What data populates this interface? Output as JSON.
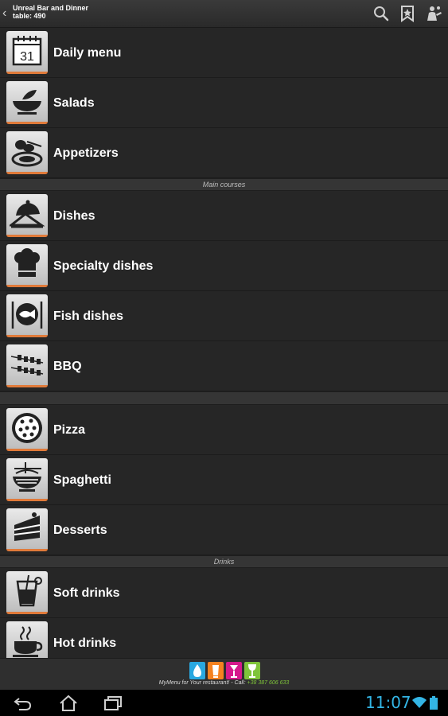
{
  "header": {
    "restaurant": "Unreal Bar and Dinner",
    "table": "table: 490"
  },
  "menu": {
    "rows": [
      {
        "label": "Daily menu",
        "icon": "calendar-icon"
      },
      {
        "label": "Salads",
        "icon": "salad-bowl-icon"
      },
      {
        "label": "Appetizers",
        "icon": "appetizer-plate-icon"
      },
      {
        "label": "Dishes",
        "icon": "cloche-icon"
      },
      {
        "label": "Specialty dishes",
        "icon": "chef-hat-icon"
      },
      {
        "label": "Fish dishes",
        "icon": "fish-plate-icon"
      },
      {
        "label": "BBQ",
        "icon": "skewers-icon"
      },
      {
        "label": "Pizza",
        "icon": "pizza-icon"
      },
      {
        "label": "Spaghetti",
        "icon": "spaghetti-bowl-icon"
      },
      {
        "label": "Desserts",
        "icon": "cake-slice-icon"
      },
      {
        "label": "Soft drinks",
        "icon": "soft-drink-glass-icon"
      },
      {
        "label": "Hot drinks",
        "icon": "coffee-cup-icon"
      }
    ],
    "sections": {
      "main_courses": "Main courses",
      "drinks": "Drinks"
    },
    "calendar_day": "31"
  },
  "footer": {
    "promo_text": "MyMenu for Your restaurant! - Call: ",
    "phone": "+38 387 606 633"
  },
  "status": {
    "time": "11:07"
  },
  "colors": {
    "accent_clock": "#33b5e5",
    "tile_underline": "#e07a3a",
    "phone_green": "#7fc43a"
  }
}
